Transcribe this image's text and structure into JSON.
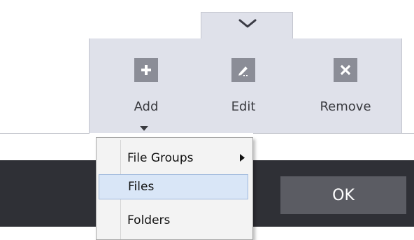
{
  "toolbar": {
    "collapse_icon": "chevron-down-icon",
    "tools": [
      {
        "label": "Add",
        "icon": "plus-icon"
      },
      {
        "label": "Edit",
        "icon": "pencil-icon"
      },
      {
        "label": "Remove",
        "icon": "close-icon"
      }
    ]
  },
  "add_menu": {
    "items": [
      {
        "label": "File Groups",
        "has_submenu": true
      },
      {
        "label": "Files",
        "highlighted": true
      },
      {
        "label": "Folders"
      }
    ]
  },
  "dialog": {
    "ok_label": "OK"
  },
  "colors": {
    "toolbar_bg": "#dfe1ea",
    "icon_box": "#8b8d97",
    "dark_bar": "#2f3036",
    "ok_button": "#5b5c63",
    "menu_highlight": "#d9e6f7"
  }
}
